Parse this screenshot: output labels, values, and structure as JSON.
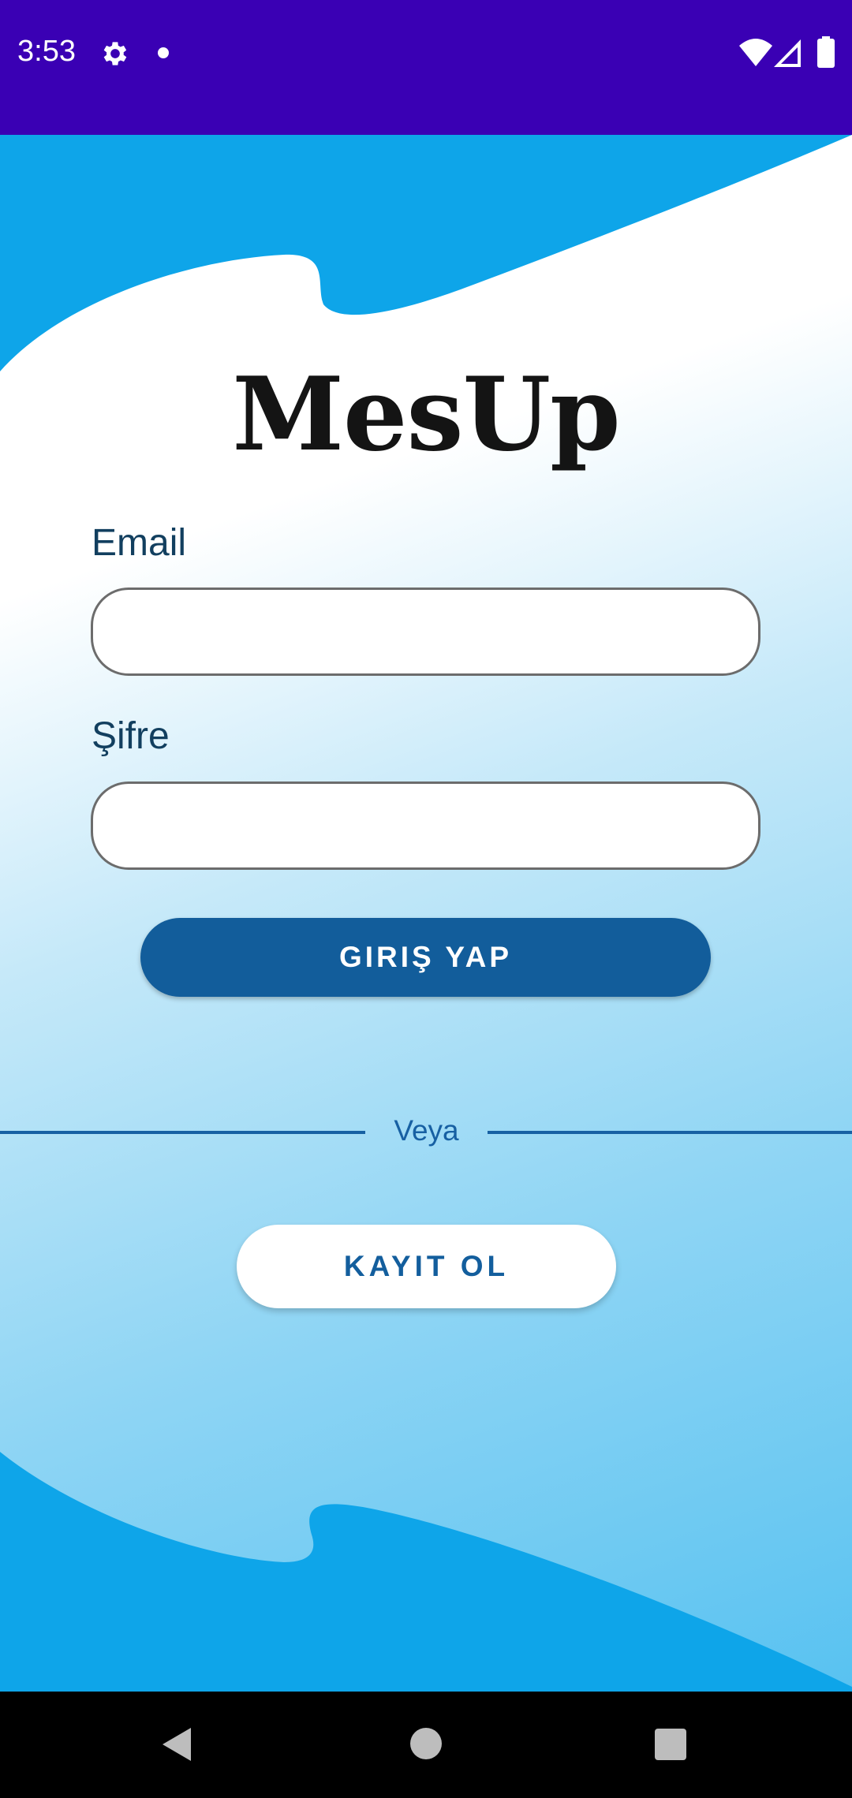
{
  "status_bar": {
    "time": "3:53",
    "icons": [
      "gear-icon",
      "notification-dot-icon",
      "wifi-icon",
      "signal-icon",
      "battery-icon"
    ],
    "background_color": "#3a00b4"
  },
  "app": {
    "title": "MesUp",
    "email": {
      "label": "Email",
      "value": "",
      "placeholder": ""
    },
    "password": {
      "label": "Şifre",
      "value": "",
      "placeholder": ""
    },
    "login_button_label": "GIRIŞ YAP",
    "divider_text": "Veya",
    "register_button_label": "KAYIT OL",
    "colors": {
      "primary": "#125d9b",
      "background_blue": "#0ea5e9",
      "label": "#123f5f"
    }
  },
  "nav_bar": {
    "icons": [
      "back-icon",
      "home-icon",
      "recents-icon"
    ]
  }
}
